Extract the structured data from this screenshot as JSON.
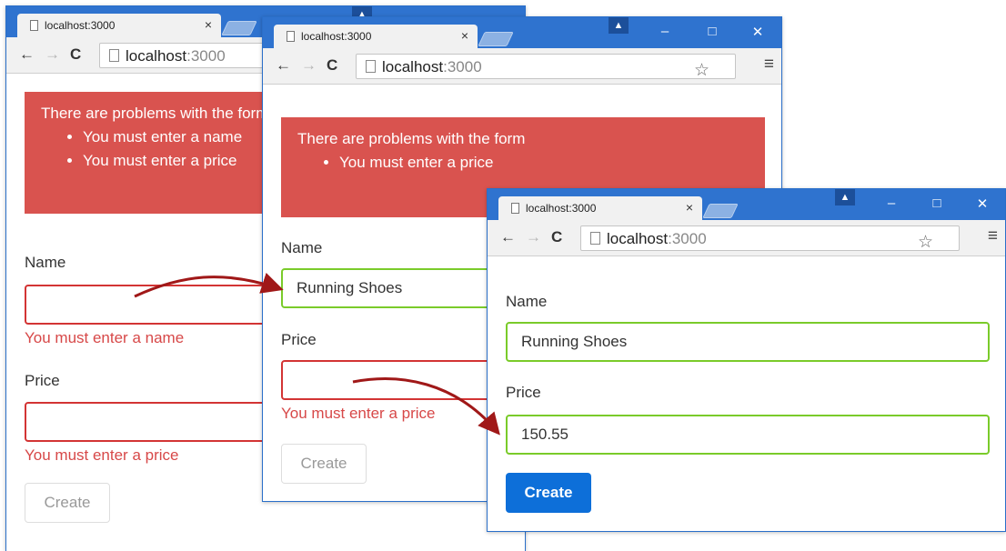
{
  "windows": [
    {
      "tab_title": "localhost:3000",
      "tab_close": "×",
      "url_host": "localhost",
      "url_port": ":3000",
      "alert": {
        "heading": "There are problems with the form",
        "items": [
          "You must enter a name",
          "You must enter a price"
        ]
      },
      "name_label": "Name",
      "name_value": "",
      "name_error": "You must enter a name",
      "price_label": "Price",
      "price_value": "",
      "price_error": "You must enter a price",
      "create_label": "Create"
    },
    {
      "tab_title": "localhost:3000",
      "tab_close": "×",
      "url_host": "localhost",
      "url_port": ":3000",
      "alert": {
        "heading": "There are problems with the form",
        "items": [
          "You must enter a price"
        ]
      },
      "name_label": "Name",
      "name_value": "Running Shoes",
      "price_label": "Price",
      "price_value": "",
      "price_error": "You must enter a price",
      "create_label": "Create"
    },
    {
      "tab_title": "localhost:3000",
      "tab_close": "×",
      "url_host": "localhost",
      "url_port": ":3000",
      "name_label": "Name",
      "name_value": "Running Shoes",
      "price_label": "Price",
      "price_value": "150.55",
      "create_label": "Create"
    }
  ],
  "colors": {
    "titlebar": "#2f73cf",
    "alert_bg": "#d9534f",
    "error_border": "#d33434",
    "error_text": "#d74848",
    "valid_border": "#7acb2a",
    "primary_button": "#0d6fd9",
    "arrow": "#a01818"
  }
}
